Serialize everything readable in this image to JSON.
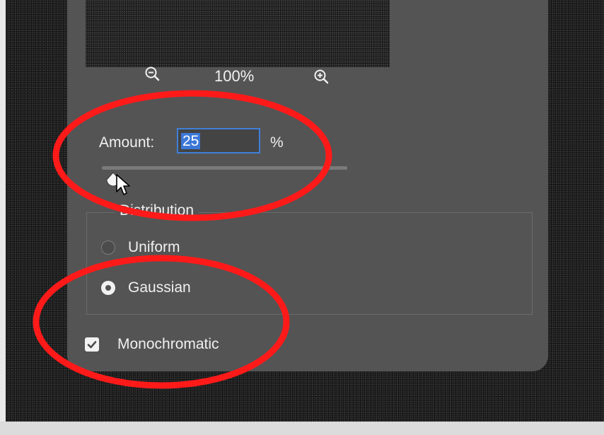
{
  "zoom": {
    "level": "100%",
    "zoom_out_icon": "zoom-out-icon",
    "zoom_in_icon": "zoom-in-icon"
  },
  "amount": {
    "label": "Amount:",
    "value": "25",
    "unit": "%",
    "slider_fraction": 0.02
  },
  "distribution": {
    "label": "Distribution",
    "options": [
      {
        "label": "Uniform",
        "selected": false
      },
      {
        "label": "Gaussian",
        "selected": true
      }
    ]
  },
  "monochromatic": {
    "label": "Monochromatic",
    "checked": true
  },
  "colors": {
    "dialog_bg": "#545454",
    "accent_blue": "#3b78d8",
    "annotation_red": "#ff1a1a"
  }
}
